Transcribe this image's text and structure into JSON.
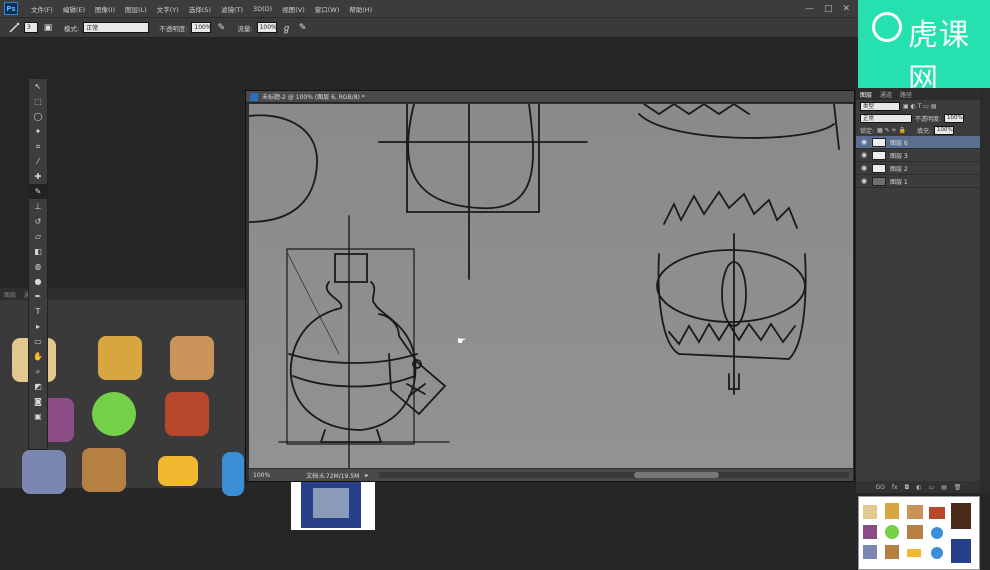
{
  "app": {
    "logo": "Ps"
  },
  "menu": {
    "items": [
      "文件(F)",
      "编辑(E)",
      "图像(I)",
      "图层(L)",
      "文字(Y)",
      "选择(S)",
      "滤镜(T)",
      "3D(D)",
      "视图(V)",
      "窗口(W)",
      "帮助(H)"
    ]
  },
  "window_controls": [
    "—",
    "□",
    "✕"
  ],
  "options": {
    "brush_size": "3",
    "mode_label": "模式:",
    "mode_value": "正常",
    "opacity_label": "不透明度:",
    "opacity_value": "100%",
    "flow_label": "流量:",
    "flow_value": "100%"
  },
  "watermark": {
    "text": "虎课网"
  },
  "document": {
    "tab_title": "未标题-2 @ 100% (图层 6, RGB/8) *",
    "zoom": "100%",
    "doc_info": "文档:6.72M/19.5M"
  },
  "asset_panel": {
    "tabs": [
      "图层",
      "通道"
    ]
  },
  "layers_panel": {
    "tabs": [
      "图层",
      "通道",
      "路径"
    ],
    "kind_value": "类型",
    "blend_value": "正常",
    "opacity_label": "不透明度:",
    "opacity_value": "100%",
    "lock_label": "锁定:",
    "fill_label": "填充:",
    "fill_value": "100%",
    "layers": [
      {
        "name": "图层 6",
        "selected": true
      },
      {
        "name": "图层 3",
        "selected": false
      },
      {
        "name": "图层 2",
        "selected": false
      },
      {
        "name": "图层 1",
        "selected": false
      }
    ],
    "bottom_icons": [
      "GO",
      "fx",
      "◘",
      "◐",
      "▭",
      "▤",
      "🗑"
    ]
  }
}
